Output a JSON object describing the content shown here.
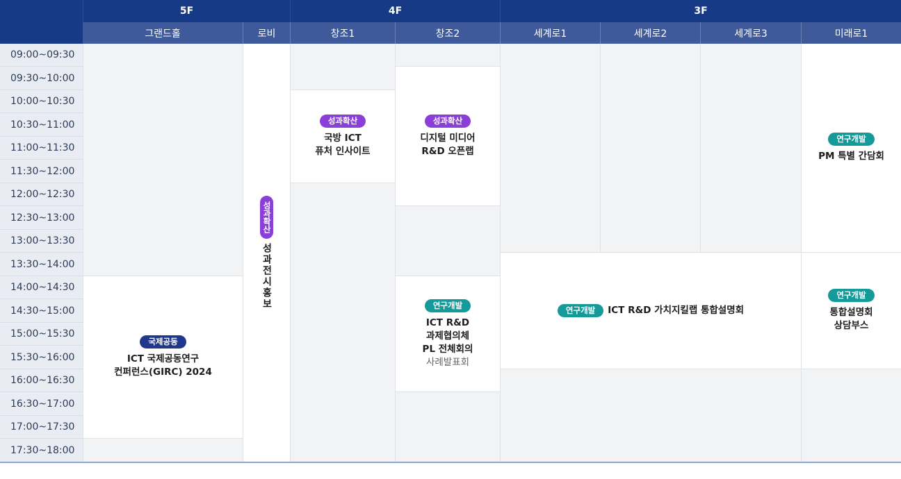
{
  "floors": {
    "f5": "5F",
    "f4": "4F",
    "f3": "3F"
  },
  "rooms": {
    "grand": "그랜드홀",
    "lobby": "로비",
    "chang1": "창조1",
    "chang2": "창조2",
    "sg1": "세계로1",
    "sg2": "세계로2",
    "sg3": "세계로3",
    "mr1": "미래로1"
  },
  "times": [
    "09:00~09:30",
    "09:30~10:00",
    "10:00~10:30",
    "10:30~11:00",
    "11:00~11:30",
    "11:30~12:00",
    "12:00~12:30",
    "12:30~13:00",
    "13:00~13:30",
    "13:30~14:00",
    "14:00~14:30",
    "14:30~15:00",
    "15:00~15:30",
    "15:30~16:00",
    "16:00~16:30",
    "16:30~17:00",
    "17:00~17:30",
    "17:30~18:00"
  ],
  "events": {
    "lobby": {
      "badge": "성과확산",
      "title": "성과전시홍보"
    },
    "girc": {
      "badge": "국제공동",
      "title": "ICT 국제공동연구\n컨퍼런스(GIRC) 2024"
    },
    "defense": {
      "badge": "성과확산",
      "title": "국방 ICT\n퓨처 인사이트"
    },
    "media": {
      "badge": "성과확산",
      "title": "디지털 미디어\nR&D 오픈랩"
    },
    "pl": {
      "badge": "연구개발",
      "title": "ICT R&D\n과제협의체\nPL  전체회의",
      "sub": "사례발표회"
    },
    "valuechain": {
      "badge": "연구개발",
      "title": "ICT R&D 가치지킬랩 통합설명회"
    },
    "pm": {
      "badge": "연구개발",
      "title": "PM 특별 간담회"
    },
    "consult": {
      "badge": "연구개발",
      "title": "통합설명회\n상담부스"
    }
  },
  "colors": {
    "header_dark": "#163a86",
    "header_room": "#3f5a9b",
    "purple": "#8b3fd9",
    "teal": "#159a9a",
    "navy": "#21378b"
  }
}
